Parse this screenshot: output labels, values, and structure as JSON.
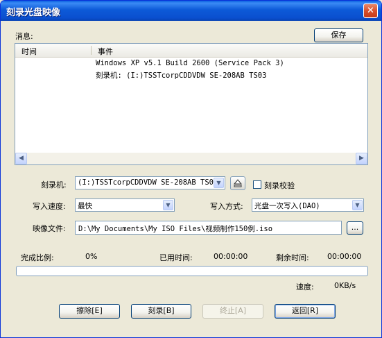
{
  "window": {
    "title": "刻录光盘映像",
    "close_glyph": "✕"
  },
  "log": {
    "label": "消息:",
    "save_button": "保存",
    "columns": [
      "时间",
      "事件"
    ],
    "rows": [
      {
        "time": "",
        "event": "Windows XP v5.1 Build 2600 (Service Pack 3)"
      },
      {
        "time": "",
        "event": "刻录机: (I:)TSSTcorpCDDVDW SE-208AB TS03"
      }
    ]
  },
  "recorder": {
    "label": "刻录机:",
    "value": "(I:)TSSTcorpCDDVDW SE-208AB TS03",
    "verify_label": "刻录校验",
    "verify_checked": false
  },
  "speed": {
    "label": "写入速度:",
    "value": "最快"
  },
  "write_mode": {
    "label": "写入方式:",
    "value": "光盘一次写入(DAO)"
  },
  "image_file": {
    "label": "映像文件:",
    "value": "D:\\My Documents\\My ISO Files\\视频制作150例.iso",
    "browse_label": "..."
  },
  "status": {
    "complete_label": "完成比例:",
    "complete_value": "0%",
    "elapsed_label": "已用时间:",
    "elapsed_value": "00:00:00",
    "remaining_label": "剩余时间:",
    "remaining_value": "00:00:00",
    "progress_fraction": 0,
    "speed_label": "速度:",
    "speed_value": "0KB/s"
  },
  "buttons": {
    "erase": "擦除[E]",
    "burn": "刻录[B]",
    "stop": "终止[A]",
    "back": "返回[R]"
  },
  "colors": {
    "titlebar": "#0a55d8",
    "face": "#ece9d8",
    "border": "#7f9db9",
    "progress": "#2fb52f"
  },
  "icons": [
    "close-icon",
    "eject-icon",
    "scroll-left-icon",
    "scroll-right-icon",
    "dropdown-arrow-icon"
  ]
}
